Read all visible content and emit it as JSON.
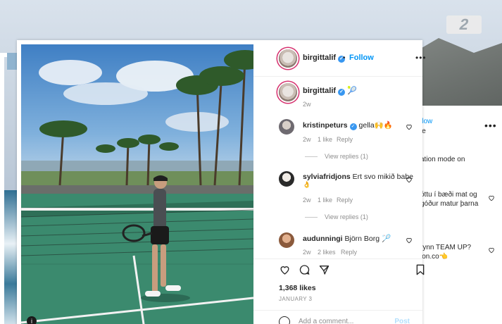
{
  "channel_logo": "2",
  "post": {
    "author": "birgittalif",
    "follow_label": "Follow",
    "dot": "•",
    "more_label": "•••",
    "caption_emoji": "🎾",
    "time_ago": "2w",
    "comments": [
      {
        "user": "kristinpeturs",
        "verified": true,
        "text": "gella🙌🔥",
        "time": "2w",
        "likes": "1 like",
        "reply_label": "Reply",
        "view_replies": "View replies (1)"
      },
      {
        "user": "sylviafridjons",
        "verified": false,
        "text": "Ert svo mikið babe",
        "text_line2": "👌",
        "time": "2w",
        "likes": "1 like",
        "reply_label": "Reply",
        "view_replies": "View replies (1)"
      },
      {
        "user": "audunningi",
        "verified": false,
        "text": "Björn Borg 🏸",
        "time": "2w",
        "likes": "2 likes",
        "reply_label": "Reply"
      }
    ],
    "likes_count": "1,368 likes",
    "date": "JANUARY 3",
    "add_comment_placeholder": "Add a comment...",
    "post_button": "Post",
    "photo_alt_icon": "i"
  },
  "back_card": {
    "follow_partial": "llow",
    "user_partial": "je",
    "line1": "ation mode on",
    "line2": "óttu í bæði mat og",
    "line3": "góður matur þarna",
    "line4": "rynn TEAM UP?",
    "line5": "lon.co👈"
  },
  "colors": {
    "accent": "#0095f6",
    "verified": "#3897f0",
    "court": "#3b8a6e"
  }
}
